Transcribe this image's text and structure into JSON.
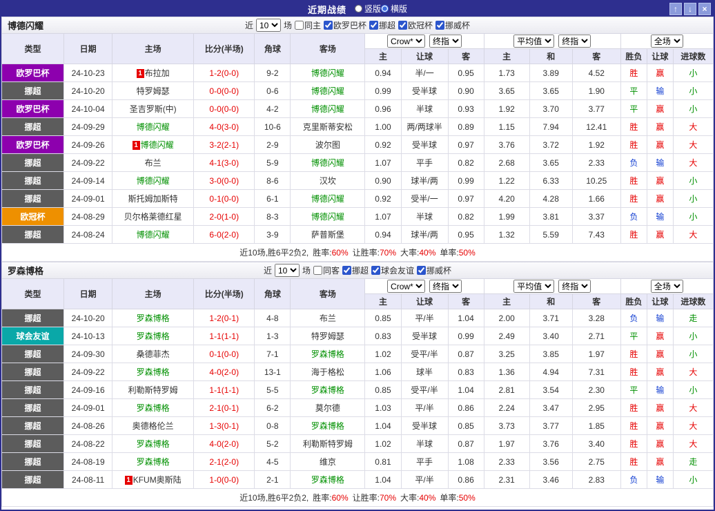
{
  "titlebar": {
    "title": "近期战绩",
    "radios": [
      {
        "label": "竖版",
        "checked": false
      },
      {
        "label": "横版",
        "checked": true
      }
    ],
    "window_buttons": {
      "up": "↑",
      "down": "↓",
      "close": "×"
    }
  },
  "header_row": {
    "type": "类型",
    "date": "日期",
    "home": "主场",
    "score": "比分(半场)",
    "corners": "角球",
    "away": "客场",
    "groups": [
      {
        "selects": [
          "Crow*",
          "终指"
        ],
        "subs": [
          "主",
          "让球",
          "客"
        ]
      },
      {
        "selects": [
          "平均值",
          "终指"
        ],
        "subs": [
          "主",
          "和",
          "客"
        ]
      },
      {
        "selects": [
          "全场"
        ],
        "subs": [
          "胜负",
          "让球",
          "进球数"
        ]
      }
    ]
  },
  "colors": {
    "league": {
      "欧罗巴杯": "#8d00ae",
      "挪超": "#5c5c5c",
      "欧冠杯": "#ee9000",
      "球会友谊": "#0aa8a8"
    },
    "result": {
      "胜": "#e60000",
      "平": "#009000",
      "负": "#1440d2",
      "赢": "#e60000",
      "输": "#1440d2",
      "大": "#e60000",
      "小": "#009000",
      "走": "#009000"
    },
    "team": "#009000",
    "score": "#e60000",
    "percent": "#e60000"
  },
  "tables": [
    {
      "team": "博德闪耀",
      "filter": {
        "near": "近",
        "count": "10",
        "games": "场",
        "same_label": "同主",
        "same_checked": false,
        "leagues": [
          {
            "label": "欧罗巴杯",
            "checked": true
          },
          {
            "label": "挪超",
            "checked": true
          },
          {
            "label": "欧冠杯",
            "checked": true
          },
          {
            "label": "挪威杯",
            "checked": true
          }
        ]
      },
      "rows": [
        {
          "league": "欧罗巴杯",
          "date": "24-10-23",
          "home": "布拉加",
          "home_badge": "1",
          "home_is_team": false,
          "score": "1-2(0-0)",
          "corners": "9-2",
          "away": "博德闪耀",
          "away_badge": "",
          "away_is_team": true,
          "odds": [
            "0.94",
            "半/一",
            "0.95"
          ],
          "avg": [
            "1.73",
            "3.89",
            "4.52"
          ],
          "res": [
            "胜",
            "赢",
            "小"
          ]
        },
        {
          "league": "挪超",
          "date": "24-10-20",
          "home": "特罗姆瑟",
          "home_badge": "",
          "home_is_team": false,
          "score": "0-0(0-0)",
          "corners": "0-6",
          "away": "博德闪耀",
          "away_badge": "",
          "away_is_team": true,
          "odds": [
            "0.99",
            "受半球",
            "0.90"
          ],
          "avg": [
            "3.65",
            "3.65",
            "1.90"
          ],
          "res": [
            "平",
            "输",
            "小"
          ]
        },
        {
          "league": "欧罗巴杯",
          "date": "24-10-04",
          "home": "圣吉罗斯(中)",
          "home_badge": "",
          "home_is_team": false,
          "score": "0-0(0-0)",
          "corners": "4-2",
          "away": "博德闪耀",
          "away_badge": "",
          "away_is_team": true,
          "odds": [
            "0.96",
            "半球",
            "0.93"
          ],
          "avg": [
            "1.92",
            "3.70",
            "3.77"
          ],
          "res": [
            "平",
            "赢",
            "小"
          ]
        },
        {
          "league": "挪超",
          "date": "24-09-29",
          "home": "博德闪耀",
          "home_badge": "",
          "home_is_team": true,
          "score": "4-0(3-0)",
          "corners": "10-6",
          "away": "克里斯蒂安松",
          "away_badge": "",
          "away_is_team": false,
          "odds": [
            "1.00",
            "两/两球半",
            "0.89"
          ],
          "avg": [
            "1.15",
            "7.94",
            "12.41"
          ],
          "res": [
            "胜",
            "赢",
            "大"
          ]
        },
        {
          "league": "欧罗巴杯",
          "date": "24-09-26",
          "home": "博德闪耀",
          "home_badge": "1",
          "home_is_team": true,
          "score": "3-2(2-1)",
          "corners": "2-9",
          "away": "波尔图",
          "away_badge": "",
          "away_is_team": false,
          "odds": [
            "0.92",
            "受半球",
            "0.97"
          ],
          "avg": [
            "3.76",
            "3.72",
            "1.92"
          ],
          "res": [
            "胜",
            "赢",
            "大"
          ]
        },
        {
          "league": "挪超",
          "date": "24-09-22",
          "home": "布兰",
          "home_badge": "",
          "home_is_team": false,
          "score": "4-1(3-0)",
          "corners": "5-9",
          "away": "博德闪耀",
          "away_badge": "",
          "away_is_team": true,
          "odds": [
            "1.07",
            "平手",
            "0.82"
          ],
          "avg": [
            "2.68",
            "3.65",
            "2.33"
          ],
          "res": [
            "负",
            "输",
            "大"
          ]
        },
        {
          "league": "挪超",
          "date": "24-09-14",
          "home": "博德闪耀",
          "home_badge": "",
          "home_is_team": true,
          "score": "3-0(0-0)",
          "corners": "8-6",
          "away": "汉坎",
          "away_badge": "",
          "away_is_team": false,
          "odds": [
            "0.90",
            "球半/两",
            "0.99"
          ],
          "avg": [
            "1.22",
            "6.33",
            "10.25"
          ],
          "res": [
            "胜",
            "赢",
            "小"
          ]
        },
        {
          "league": "挪超",
          "date": "24-09-01",
          "home": "斯托姆加斯特",
          "home_badge": "",
          "home_is_team": false,
          "score": "0-1(0-0)",
          "corners": "6-1",
          "away": "博德闪耀",
          "away_badge": "",
          "away_is_team": true,
          "odds": [
            "0.92",
            "受半/一",
            "0.97"
          ],
          "avg": [
            "4.20",
            "4.28",
            "1.66"
          ],
          "res": [
            "胜",
            "赢",
            "小"
          ]
        },
        {
          "league": "欧冠杯",
          "date": "24-08-29",
          "home": "贝尔格莱德红星",
          "home_badge": "",
          "home_is_team": false,
          "score": "2-0(1-0)",
          "corners": "8-3",
          "away": "博德闪耀",
          "away_badge": "",
          "away_is_team": true,
          "odds": [
            "1.07",
            "半球",
            "0.82"
          ],
          "avg": [
            "1.99",
            "3.81",
            "3.37"
          ],
          "res": [
            "负",
            "输",
            "小"
          ]
        },
        {
          "league": "挪超",
          "date": "24-08-24",
          "home": "博德闪耀",
          "home_badge": "",
          "home_is_team": true,
          "score": "6-0(2-0)",
          "corners": "3-9",
          "away": "萨普斯堡",
          "away_badge": "",
          "away_is_team": false,
          "odds": [
            "0.94",
            "球半/两",
            "0.95"
          ],
          "avg": [
            "1.32",
            "5.59",
            "7.43"
          ],
          "res": [
            "胜",
            "赢",
            "大"
          ]
        }
      ],
      "summary": {
        "prefix": "近10场,胜6平2负2,",
        "stats": [
          {
            "label": "胜率:",
            "value": "60%"
          },
          {
            "label": "让胜率:",
            "value": "70%"
          },
          {
            "label": "大率:",
            "value": "40%"
          },
          {
            "label": "单率:",
            "value": "50%"
          }
        ]
      }
    },
    {
      "team": "罗森博格",
      "filter": {
        "near": "近",
        "count": "10",
        "games": "场",
        "same_label": "同客",
        "same_checked": false,
        "leagues": [
          {
            "label": "挪超",
            "checked": true
          },
          {
            "label": "球会友谊",
            "checked": true
          },
          {
            "label": "挪威杯",
            "checked": true
          }
        ]
      },
      "rows": [
        {
          "league": "挪超",
          "date": "24-10-20",
          "home": "罗森博格",
          "home_badge": "",
          "home_is_team": true,
          "score": "1-2(0-1)",
          "corners": "4-8",
          "away": "布兰",
          "away_badge": "",
          "away_is_team": false,
          "odds": [
            "0.85",
            "平/半",
            "1.04"
          ],
          "avg": [
            "2.00",
            "3.71",
            "3.28"
          ],
          "res": [
            "负",
            "输",
            "走"
          ]
        },
        {
          "league": "球会友谊",
          "date": "24-10-13",
          "home": "罗森博格",
          "home_badge": "",
          "home_is_team": true,
          "score": "1-1(1-1)",
          "corners": "1-3",
          "away": "特罗姆瑟",
          "away_badge": "",
          "away_is_team": false,
          "odds": [
            "0.83",
            "受半球",
            "0.99"
          ],
          "avg": [
            "2.49",
            "3.40",
            "2.71"
          ],
          "res": [
            "平",
            "赢",
            "小"
          ]
        },
        {
          "league": "挪超",
          "date": "24-09-30",
          "home": "桑德菲杰",
          "home_badge": "",
          "home_is_team": false,
          "score": "0-1(0-0)",
          "corners": "7-1",
          "away": "罗森博格",
          "away_badge": "",
          "away_is_team": true,
          "odds": [
            "1.02",
            "受平/半",
            "0.87"
          ],
          "avg": [
            "3.25",
            "3.85",
            "1.97"
          ],
          "res": [
            "胜",
            "赢",
            "小"
          ]
        },
        {
          "league": "挪超",
          "date": "24-09-22",
          "home": "罗森博格",
          "home_badge": "",
          "home_is_team": true,
          "score": "4-0(2-0)",
          "corners": "13-1",
          "away": "海于格松",
          "away_badge": "",
          "away_is_team": false,
          "odds": [
            "1.06",
            "球半",
            "0.83"
          ],
          "avg": [
            "1.36",
            "4.94",
            "7.31"
          ],
          "res": [
            "胜",
            "赢",
            "大"
          ]
        },
        {
          "league": "挪超",
          "date": "24-09-16",
          "home": "利勒斯特罗姆",
          "home_badge": "",
          "home_is_team": false,
          "score": "1-1(1-1)",
          "corners": "5-5",
          "away": "罗森博格",
          "away_badge": "",
          "away_is_team": true,
          "odds": [
            "0.85",
            "受平/半",
            "1.04"
          ],
          "avg": [
            "2.81",
            "3.54",
            "2.30"
          ],
          "res": [
            "平",
            "输",
            "小"
          ]
        },
        {
          "league": "挪超",
          "date": "24-09-01",
          "home": "罗森博格",
          "home_badge": "",
          "home_is_team": true,
          "score": "2-1(0-1)",
          "corners": "6-2",
          "away": "莫尔德",
          "away_badge": "",
          "away_is_team": false,
          "odds": [
            "1.03",
            "平/半",
            "0.86"
          ],
          "avg": [
            "2.24",
            "3.47",
            "2.95"
          ],
          "res": [
            "胜",
            "赢",
            "大"
          ]
        },
        {
          "league": "挪超",
          "date": "24-08-26",
          "home": "奥德格伦兰",
          "home_badge": "",
          "home_is_team": false,
          "score": "1-3(0-1)",
          "corners": "0-8",
          "away": "罗森博格",
          "away_badge": "",
          "away_is_team": true,
          "odds": [
            "1.04",
            "受半球",
            "0.85"
          ],
          "avg": [
            "3.73",
            "3.77",
            "1.85"
          ],
          "res": [
            "胜",
            "赢",
            "大"
          ]
        },
        {
          "league": "挪超",
          "date": "24-08-22",
          "home": "罗森博格",
          "home_badge": "",
          "home_is_team": true,
          "score": "4-0(2-0)",
          "corners": "5-2",
          "away": "利勒斯特罗姆",
          "away_badge": "",
          "away_is_team": false,
          "odds": [
            "1.02",
            "半球",
            "0.87"
          ],
          "avg": [
            "1.97",
            "3.76",
            "3.40"
          ],
          "res": [
            "胜",
            "赢",
            "大"
          ]
        },
        {
          "league": "挪超",
          "date": "24-08-19",
          "home": "罗森博格",
          "home_badge": "",
          "home_is_team": true,
          "score": "2-1(2-0)",
          "corners": "4-5",
          "away": "维京",
          "away_badge": "",
          "away_is_team": false,
          "odds": [
            "0.81",
            "平手",
            "1.08"
          ],
          "avg": [
            "2.33",
            "3.56",
            "2.75"
          ],
          "res": [
            "胜",
            "赢",
            "走"
          ]
        },
        {
          "league": "挪超",
          "date": "24-08-11",
          "home": "KFUM奥斯陆",
          "home_badge": "1",
          "home_is_team": false,
          "score": "1-0(0-0)",
          "corners": "2-1",
          "away": "罗森博格",
          "away_badge": "",
          "away_is_team": true,
          "odds": [
            "1.04",
            "平/半",
            "0.86"
          ],
          "avg": [
            "2.31",
            "3.46",
            "2.83"
          ],
          "res": [
            "负",
            "输",
            "小"
          ]
        }
      ],
      "summary": {
        "prefix": "近10场,胜6平2负2,",
        "stats": [
          {
            "label": "胜率:",
            "value": "60%"
          },
          {
            "label": "让胜率:",
            "value": "70%"
          },
          {
            "label": "大率:",
            "value": "40%"
          },
          {
            "label": "单率:",
            "value": "50%"
          }
        ]
      }
    }
  ]
}
